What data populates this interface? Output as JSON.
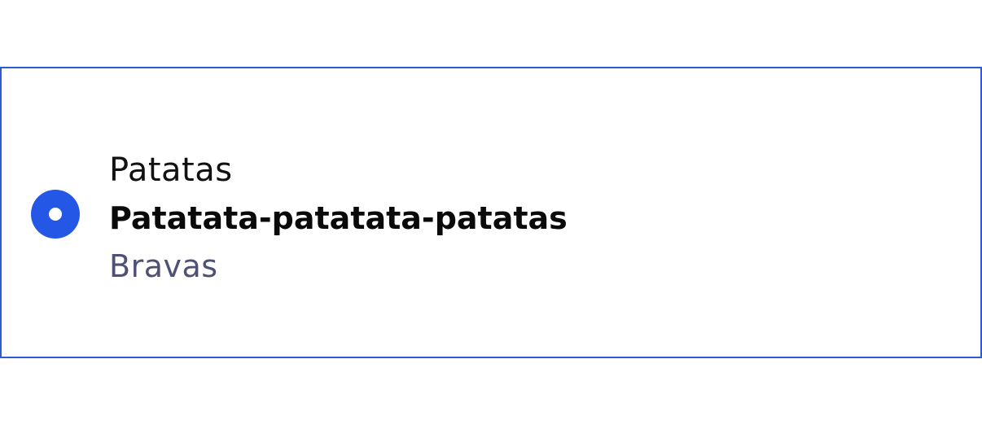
{
  "option": {
    "label": "Patatas",
    "description": "Patatata-patatata-patatas",
    "hint": "Bravas",
    "selected": true
  },
  "colors": {
    "accent": "#2457e6",
    "border": "#2c5bd2",
    "label": "#111111",
    "description": "#0a0a0a",
    "hint": "#4e5176"
  }
}
